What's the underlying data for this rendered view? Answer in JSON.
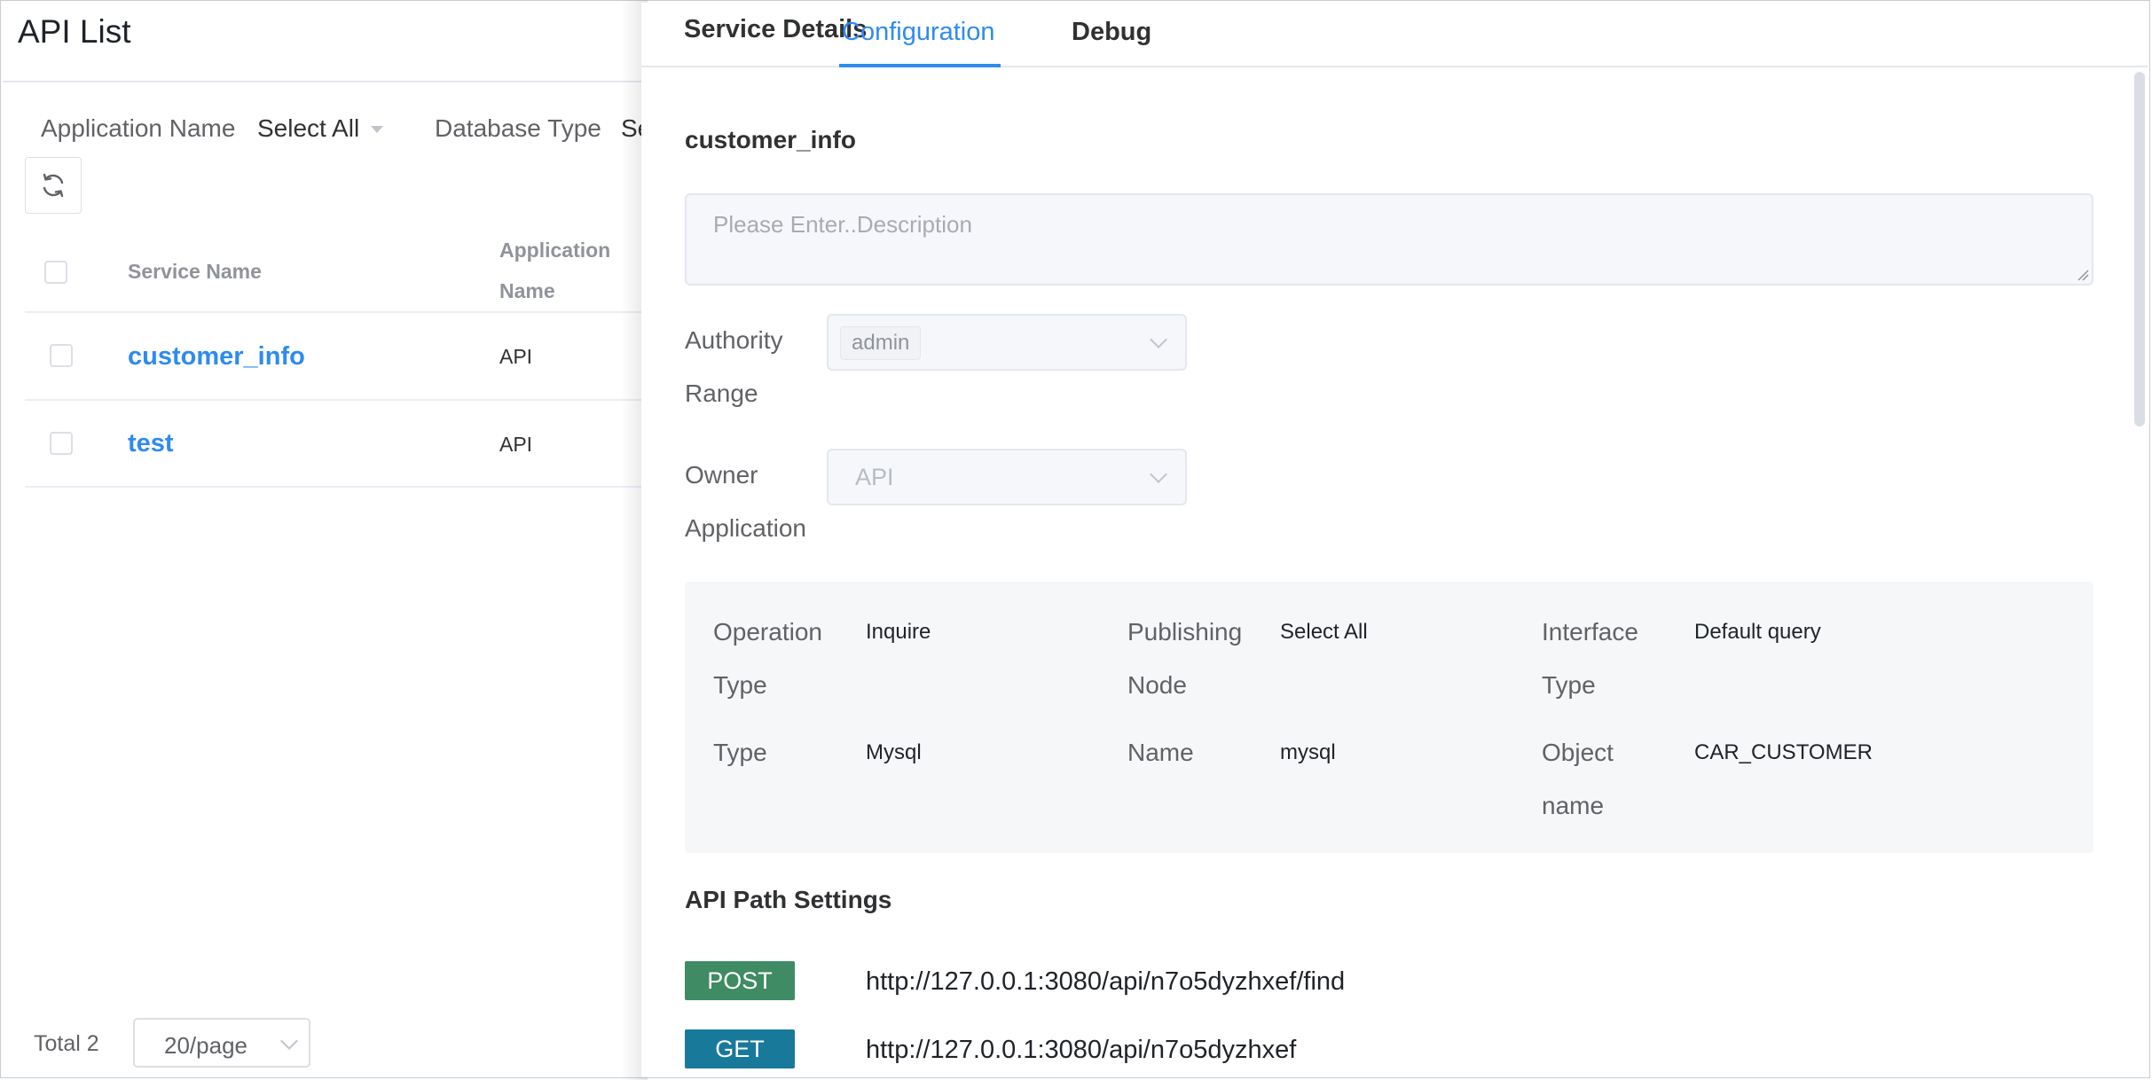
{
  "list_page": {
    "title": "API List",
    "filters": [
      {
        "label": "Application Name",
        "value": "Select All"
      },
      {
        "label": "Database Type",
        "value": "Se"
      }
    ],
    "columns": {
      "service_name": "Service Name",
      "application_name_line1": "Application",
      "application_name_line2": "Name"
    },
    "rows": [
      {
        "service_name": "customer_info",
        "application_name": "API"
      },
      {
        "service_name": "test",
        "application_name": "API"
      }
    ],
    "pagination": {
      "total_label": "Total 2",
      "page_size": "20/page"
    }
  },
  "drawer": {
    "tabs": [
      "Service Details",
      "Configuration",
      "Debug"
    ],
    "active_tab": "Configuration",
    "service_name": "customer_info",
    "description_placeholder": "Please Enter..Description",
    "authority_range": {
      "label_line1": "Authority",
      "label_line2": "Range",
      "tag": "admin"
    },
    "owner_application": {
      "label_line1": "Owner",
      "label_line2": "Application",
      "placeholder": "API"
    },
    "info": {
      "operation_type": {
        "label_line1": "Operation",
        "label_line2": "Type",
        "value": "Inquire"
      },
      "publishing_node": {
        "label_line1": "Publishing",
        "label_line2": "Node",
        "value": "Select All"
      },
      "interface_type": {
        "label_line1": "Interface",
        "label_line2": "Type",
        "value": "Default query"
      },
      "type": {
        "label": "Type",
        "value": "Mysql"
      },
      "name": {
        "label": "Name",
        "value": "mysql"
      },
      "object_name": {
        "label_line1": "Object",
        "label_line2": "name",
        "value": "CAR_CUSTOMER"
      }
    },
    "api_path_settings": {
      "title": "API Path Settings",
      "paths": [
        {
          "method": "POST",
          "url": "http://127.0.0.1:3080/api/n7o5dyzhxef/find"
        },
        {
          "method": "GET",
          "url": "http://127.0.0.1:3080/api/n7o5dyzhxef"
        }
      ]
    }
  },
  "colors": {
    "accent": "#2e8bf0",
    "post_badge": "#3f8b63",
    "get_badge": "#19799b"
  }
}
